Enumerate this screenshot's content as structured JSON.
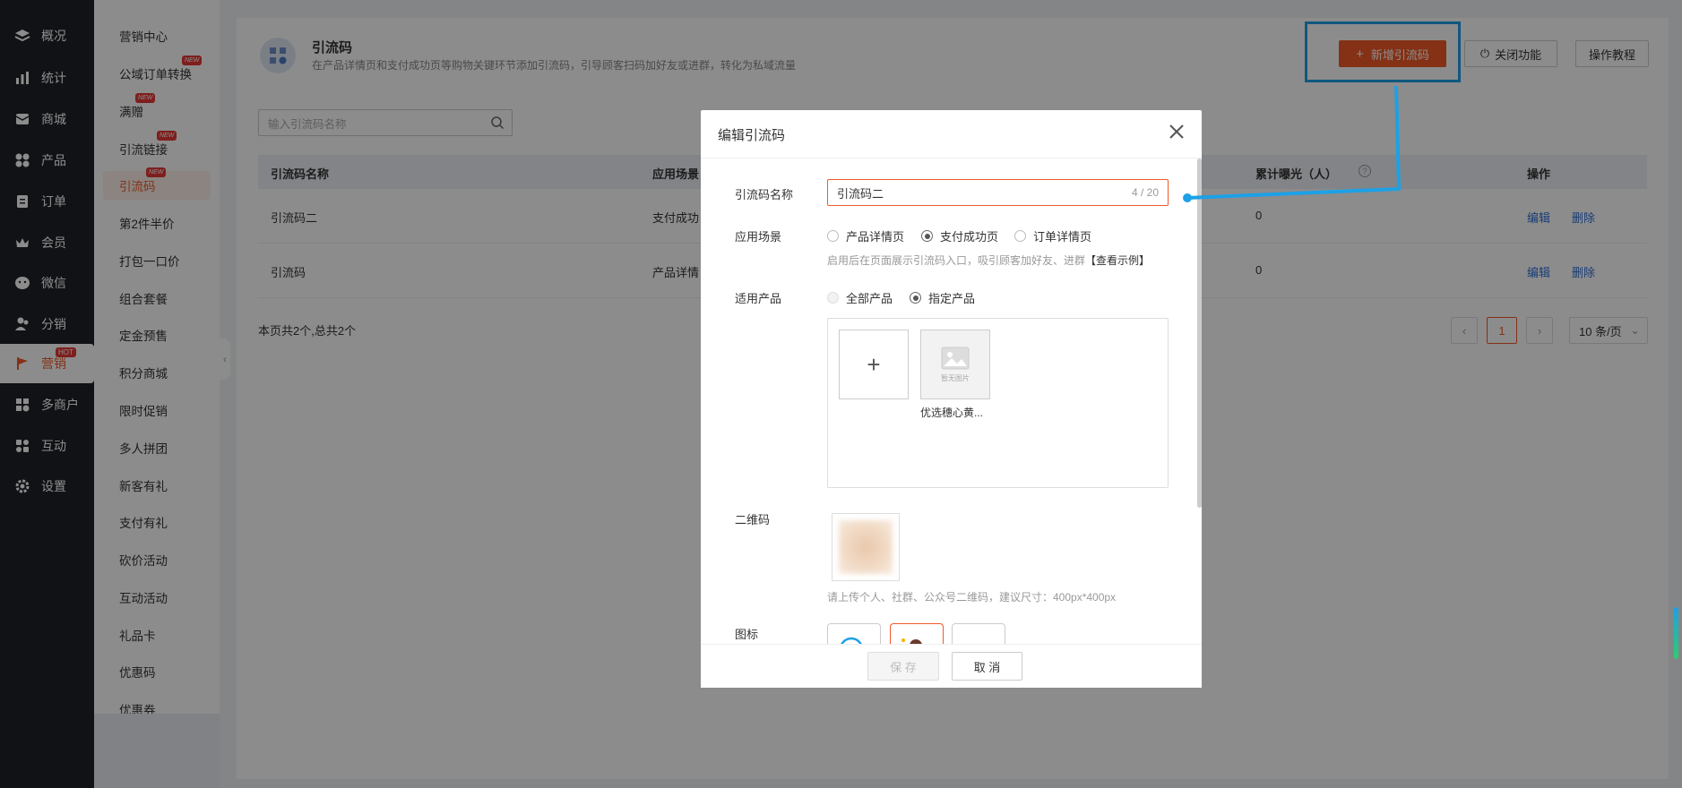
{
  "nav": {
    "items": [
      {
        "label": "概况",
        "icon": "layers-icon"
      },
      {
        "label": "统计",
        "icon": "chart-icon"
      },
      {
        "label": "商城",
        "icon": "mail-icon"
      },
      {
        "label": "产品",
        "icon": "grid-icon"
      },
      {
        "label": "订单",
        "icon": "clipboard-icon"
      },
      {
        "label": "会员",
        "icon": "crown-icon"
      },
      {
        "label": "微信",
        "icon": "wechat-icon"
      },
      {
        "label": "分销",
        "icon": "users-icon"
      },
      {
        "label": "营销",
        "icon": "flag-icon",
        "badge": "HOT"
      },
      {
        "label": "多商户",
        "icon": "store-icon"
      },
      {
        "label": "互动",
        "icon": "interact-icon"
      },
      {
        "label": "设置",
        "icon": "gear-icon"
      }
    ]
  },
  "subnav": {
    "items": [
      {
        "label": "营销中心"
      },
      {
        "label": "公域订单转换",
        "badge": "NEW"
      },
      {
        "label": "满赠",
        "badge": "NEW"
      },
      {
        "label": "引流链接",
        "badge": "NEW"
      },
      {
        "label": "引流码",
        "badge": "NEW"
      },
      {
        "label": "第2件半价"
      },
      {
        "label": "打包一口价"
      },
      {
        "label": "组合套餐"
      },
      {
        "label": "定金预售"
      },
      {
        "label": "积分商城"
      },
      {
        "label": "限时促销"
      },
      {
        "label": "多人拼团"
      },
      {
        "label": "新客有礼"
      },
      {
        "label": "支付有礼"
      },
      {
        "label": "砍价活动"
      },
      {
        "label": "互动活动"
      },
      {
        "label": "礼品卡"
      },
      {
        "label": "优惠码"
      },
      {
        "label": "优惠券"
      }
    ]
  },
  "header": {
    "title": "引流码",
    "description": "在产品详情页和支付成功页等购物关键环节添加引流码，引导顾客扫码加好友或进群，转化为私域流量",
    "add_button": "新增引流码",
    "close_button": "关闭功能",
    "tutorial_button": "操作教程"
  },
  "search": {
    "placeholder": "输入引流码名称"
  },
  "table": {
    "columns": [
      "引流码名称",
      "应用场景",
      "累计曝光（人）",
      "操作"
    ],
    "rows": [
      {
        "name": "引流码二",
        "scene": "支付成功",
        "exposure": "0",
        "edit": "编辑",
        "delete": "删除"
      },
      {
        "name": "引流码",
        "scene": "产品详情",
        "exposure": "0",
        "edit": "编辑",
        "delete": "删除"
      }
    ],
    "footer_total": "本页共2个,总共2个"
  },
  "pagination": {
    "current": "1",
    "page_size": "10 条/页"
  },
  "modal": {
    "title": "编辑引流码",
    "name_label": "引流码名称",
    "name_value": "引流码二",
    "name_count": "4 / 20",
    "scene_label": "应用场景",
    "scene_options": [
      "产品详情页",
      "支付成功页",
      "订单详情页"
    ],
    "scene_selected": "支付成功页",
    "scene_hint": "启用后在页面展示引流码入口，吸引顾客加好友、进群",
    "scene_example": "【查看示例】",
    "product_label": "适用产品",
    "product_options": [
      "全部产品",
      "指定产品"
    ],
    "product_selected": "指定产品",
    "product_name": "优选穗心黄...",
    "no_image_text": "暂无图片",
    "qr_label": "二维码",
    "qr_hint": "请上传个人、社群、公众号二维码，建议尺寸：400px*400px",
    "icon_label": "图标",
    "save_button": "保 存",
    "cancel_button": "取 消"
  },
  "colors": {
    "accent": "#f05a28",
    "annotation": "#1ca1e6",
    "nav_bg": "#1f2229",
    "link": "#2d6fd6"
  }
}
